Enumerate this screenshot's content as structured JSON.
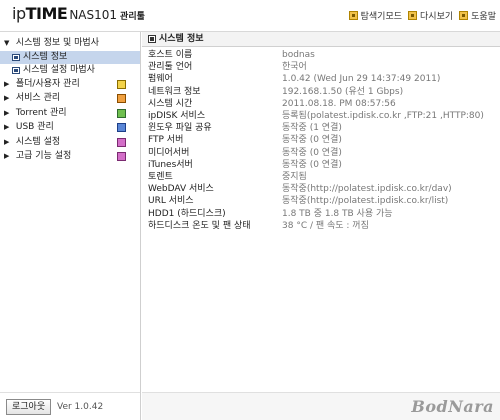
{
  "header": {
    "logo_ip": "ip",
    "logo_time": "TIME",
    "logo_model": "NAS101",
    "logo_admin": "관리툴",
    "links": [
      {
        "label": "탐색기모드"
      },
      {
        "label": "다시보기"
      },
      {
        "label": "도움말"
      }
    ]
  },
  "sidebar": {
    "group": "시스템 정보 및 마법사",
    "sub_items": [
      {
        "label": "시스템 정보",
        "selected": true
      },
      {
        "label": "시스템 설정 마법사",
        "selected": false
      }
    ],
    "items": [
      {
        "label": "폴더/사용자 관리",
        "icon": "folder-user-icon",
        "icon_color": "#d9b000"
      },
      {
        "label": "서비스 관리",
        "icon": "service-icon",
        "icon_color": "#e07000"
      },
      {
        "label": "Torrent 관리",
        "icon": "torrent-icon",
        "icon_color": "#2f7a2f"
      },
      {
        "label": "USB 관리",
        "icon": "usb-icon",
        "icon_color": "#1d4fa8"
      },
      {
        "label": "시스템 설정",
        "icon": "system-settings-icon",
        "icon_color": "#b83aa8"
      },
      {
        "label": "고급 기능 설정",
        "icon": "advanced-settings-icon",
        "icon_color": "#b83aa8"
      }
    ],
    "logout_label": "로그아웃",
    "version": "Ver 1.0.42"
  },
  "main": {
    "title": "시스템 정보",
    "rows": [
      {
        "key": "호스트 이름",
        "value": "bodnas"
      },
      {
        "key": "관리툴 언어",
        "value": "한국어"
      },
      {
        "key": "펌웨어",
        "value": "1.0.42 (Wed Jun 29 14:37:49 2011)"
      },
      {
        "key": "네트워크 정보",
        "value": "192.168.1.50 (유선 1 Gbps)"
      },
      {
        "key": "시스템 시간",
        "value": "2011.08.18. PM 08:57:56"
      },
      {
        "key": "ipDISK 서비스",
        "value": "등록됨(polatest.ipdisk.co.kr ,FTP:21 ,HTTP:80)"
      },
      {
        "key": "윈도우 파일 공유",
        "value": "동작중 (1 연결)"
      },
      {
        "key": "FTP 서버",
        "value": "동작중 (0 연결)"
      },
      {
        "key": "미디어서버",
        "value": "동작중 (0 연결)"
      },
      {
        "key": "iTunes서버",
        "value": "동작중 (0 연결)"
      },
      {
        "key": "토렌트",
        "value": "중지됨"
      },
      {
        "key": "WebDAV 서비스",
        "value": "동작중(http://polatest.ipdisk.co.kr/dav)"
      },
      {
        "key": "URL 서비스",
        "value": "동작중(http://polatest.ipdisk.co.kr/list)"
      },
      {
        "key": "HDD1 (하드디스크)",
        "value": "1.8 TB 중 1.8 TB 사용 가능"
      },
      {
        "key": "하드디스크 온도 및 팬 상태",
        "value": "38 °C / 팬 속도 : 꺼짐"
      }
    ]
  },
  "watermark": "BodNara",
  "colors": {
    "selected_bg": "#c5d5ec",
    "accent_icon": "#f1c24b"
  }
}
